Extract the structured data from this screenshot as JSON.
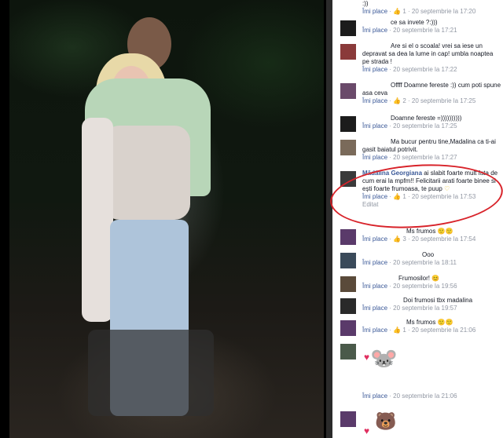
{
  "comments": [
    {
      "text": ":))",
      "like_label": "Îmi place",
      "likes": "1",
      "time": "20 septembrie la 17:20"
    },
    {
      "text": "ce sa invete ?:)))",
      "like_label": "Îmi place",
      "likes": "",
      "time": "20 septembrie la 17:21"
    },
    {
      "text": "Are si el o scoala! vrei sa iese un depravat sa dea la lume in cap! umbla noaptea pe strada !",
      "like_label": "Îmi place",
      "likes": "",
      "time": "20 septembrie la 17:22"
    },
    {
      "text": "Offff Doamne fereste :)) cum poti spune asa ceva",
      "like_label": "Îmi place",
      "likes": "2",
      "time": "20 septembrie la 17:25"
    },
    {
      "text": "Doamne fereste =))))))))))",
      "like_label": "Îmi place",
      "likes": "",
      "time": "20 septembrie la 17:25"
    },
    {
      "text": "Ma bucur pentru tine,Madalina ca ti-ai gasit baiatul potrivit.",
      "like_label": "Îmi place",
      "likes": "",
      "time": "20 septembrie la 17:27"
    },
    {
      "name": "Mădălina Georgiana",
      "text": "ai slabit foarte mult fata de cum erai la mpfm!! Felicitarii arati foarte binee si ești foarte frumoasa, te puup",
      "like_label": "Îmi place",
      "likes": "1",
      "time": "20 septembrie la 17:53",
      "edited": "Editat"
    },
    {
      "text": "Ms frumos",
      "like_label": "Îmi place",
      "likes": "3",
      "time": "20 septembrie la 17:54"
    },
    {
      "text": "Ooo",
      "like_label": "Îmi place",
      "likes": "",
      "time": "20 septembrie la 18:11"
    },
    {
      "text": "Frumosilor!",
      "like_label": "Îmi place",
      "likes": "",
      "time": "20 septembrie la 19:56"
    },
    {
      "text": "Doi frumosi tbx madalina",
      "like_label": "Îmi place",
      "likes": "",
      "time": "20 septembrie la 19:57"
    },
    {
      "text": "Ms frumos",
      "like_label": "Îmi place",
      "likes": "1",
      "time": "20 septembrie la 21:06"
    },
    {
      "text": "",
      "like_label": "Îmi place",
      "likes": "",
      "time": "20 septembrie la 21:06"
    }
  ],
  "colors": {
    "link": "#3b5998",
    "meta": "#9197a3",
    "highlight": "#d8232a"
  }
}
